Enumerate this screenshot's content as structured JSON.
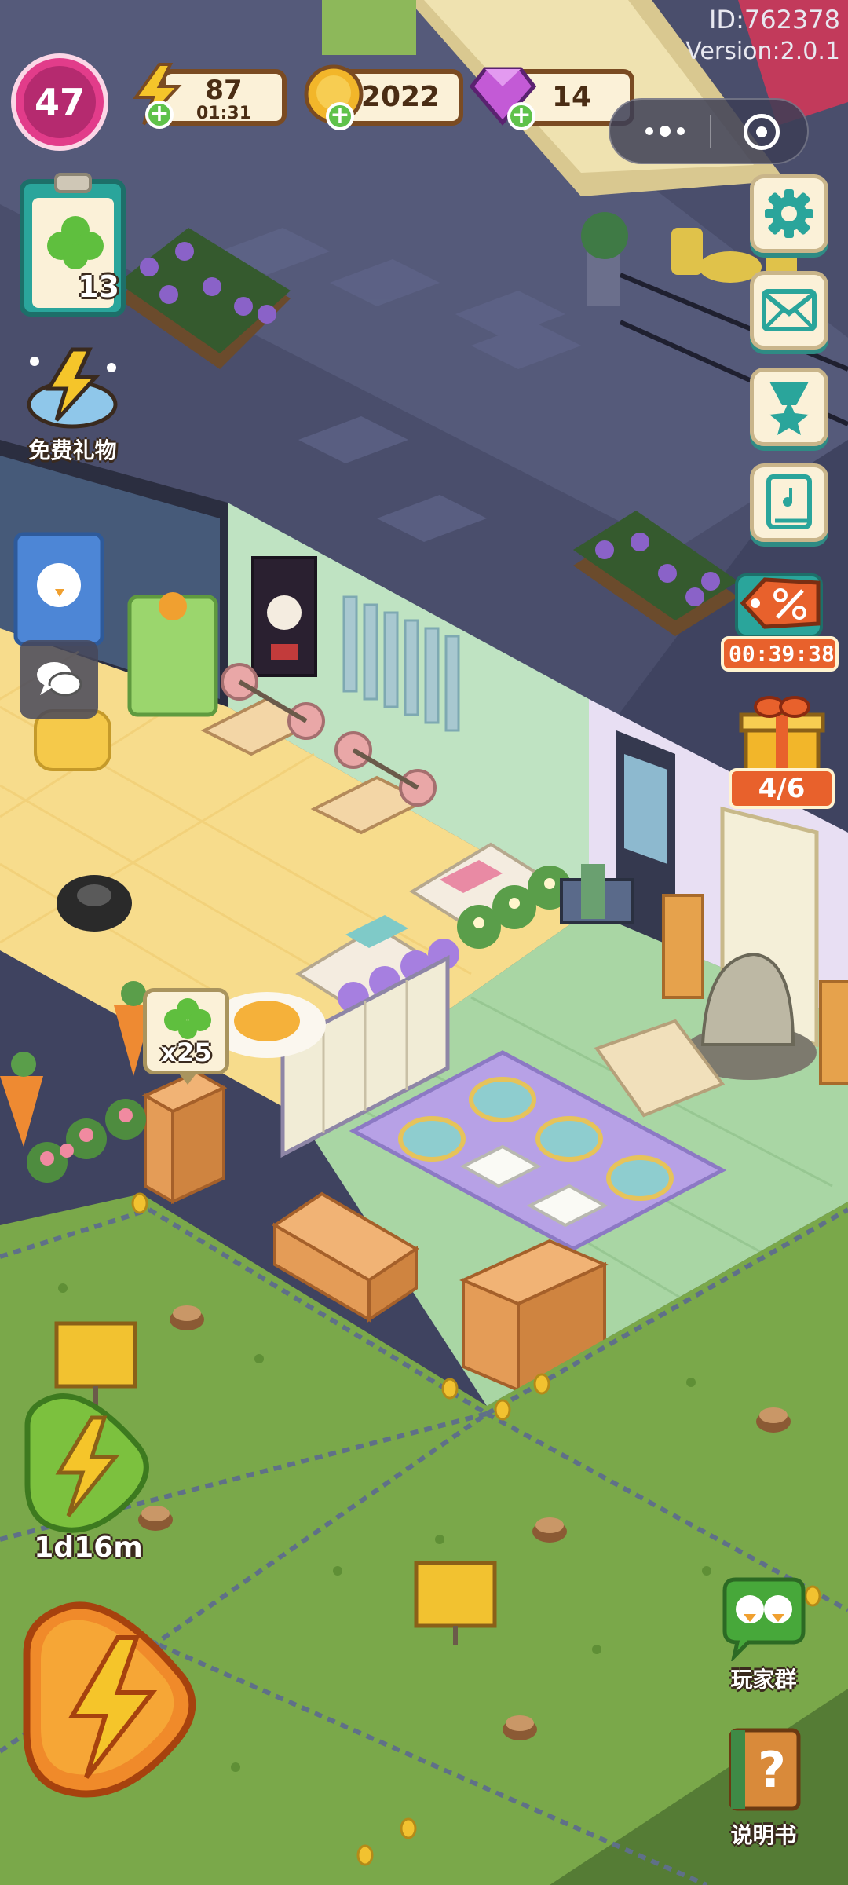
{
  "header": {
    "player_id": "ID:762378",
    "version": "Version:2.0.1"
  },
  "player": {
    "level": "47"
  },
  "resources": {
    "energy": {
      "value": "87",
      "timer": "01:31",
      "icon": "lightning-icon"
    },
    "coins": {
      "value": "2022",
      "icon": "coin-icon"
    },
    "gems": {
      "value": "14",
      "icon": "gem-icon"
    }
  },
  "miniprogram": {
    "more_icon": "more-dots-icon",
    "close_icon": "target-close-icon"
  },
  "left_panel": {
    "quest_count": "13",
    "free_gift_label": "免费礼物"
  },
  "right_panel": {
    "settings_icon": "gear-icon",
    "mail_icon": "envelope-icon",
    "ranking_icon": "ribbon-star-icon",
    "guide_book_icon": "book-icon",
    "sale_timer": "00:39:38",
    "sale_icon": "percent-tag-icon",
    "gift_progress": "4/6",
    "player_group_label": "玩家群",
    "manual_label": "说明书"
  },
  "scene": {
    "clover_reward": "x25"
  },
  "bottom_left": {
    "boost_timer": "1d16m"
  },
  "colors": {
    "level_ring": "#e23c8a",
    "pill_border": "#7a4b22",
    "pill_fill": "#fbf1d8",
    "side_button_fill": "#fbf1d8",
    "side_button_icon": "#2aa59b",
    "sale_orange": "#e8612c",
    "lawn_green": "#7aa84a",
    "floor_yellow": "#f7dc8c",
    "floor_mint": "#a9d6a4"
  }
}
